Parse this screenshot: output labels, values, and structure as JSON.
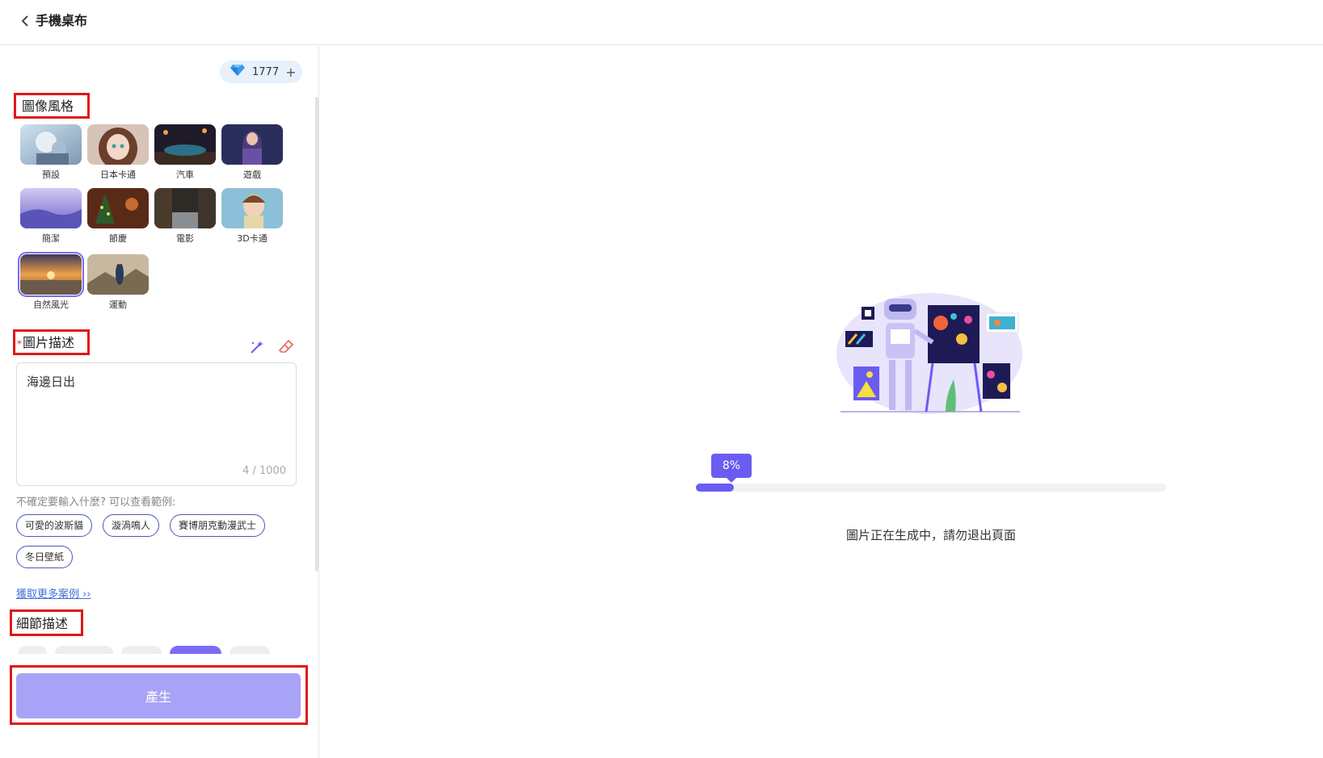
{
  "header": {
    "title": "手機桌布"
  },
  "credits": {
    "amount": "1777",
    "plus": "+"
  },
  "style_section": {
    "label": "圖像風格",
    "items": [
      {
        "label": "預設",
        "selected": false
      },
      {
        "label": "日本卡通",
        "selected": false
      },
      {
        "label": "汽車",
        "selected": false
      },
      {
        "label": "遊戲",
        "selected": false
      },
      {
        "label": "簡潔",
        "selected": false
      },
      {
        "label": "節慶",
        "selected": false
      },
      {
        "label": "電影",
        "selected": false
      },
      {
        "label": "3D卡通",
        "selected": false
      },
      {
        "label": "自然風光",
        "selected": true
      },
      {
        "label": "運動",
        "selected": false
      }
    ]
  },
  "prompt_section": {
    "required_mark": "*",
    "label": "圖片描述",
    "value": "海邊日出",
    "count": "4 / 1000"
  },
  "examples": {
    "hint": "不確定要輸入什麼? 可以查看範例:",
    "chips": [
      "可愛的波斯貓",
      "漩渦鳴人",
      "賽博朋克動漫武士",
      "冬日壁紙"
    ],
    "more_link": "獲取更多案例 ››"
  },
  "detail_section": {
    "label": "細節描述"
  },
  "generate_button": {
    "label": "產生"
  },
  "progress": {
    "percent_label": "8%",
    "percent": 8,
    "status": "圖片正在生成中，請勿退出頁面"
  },
  "colors": {
    "accent": "#6a5cf0",
    "button": "#a9a3f7",
    "highlight_box": "#e01818"
  }
}
